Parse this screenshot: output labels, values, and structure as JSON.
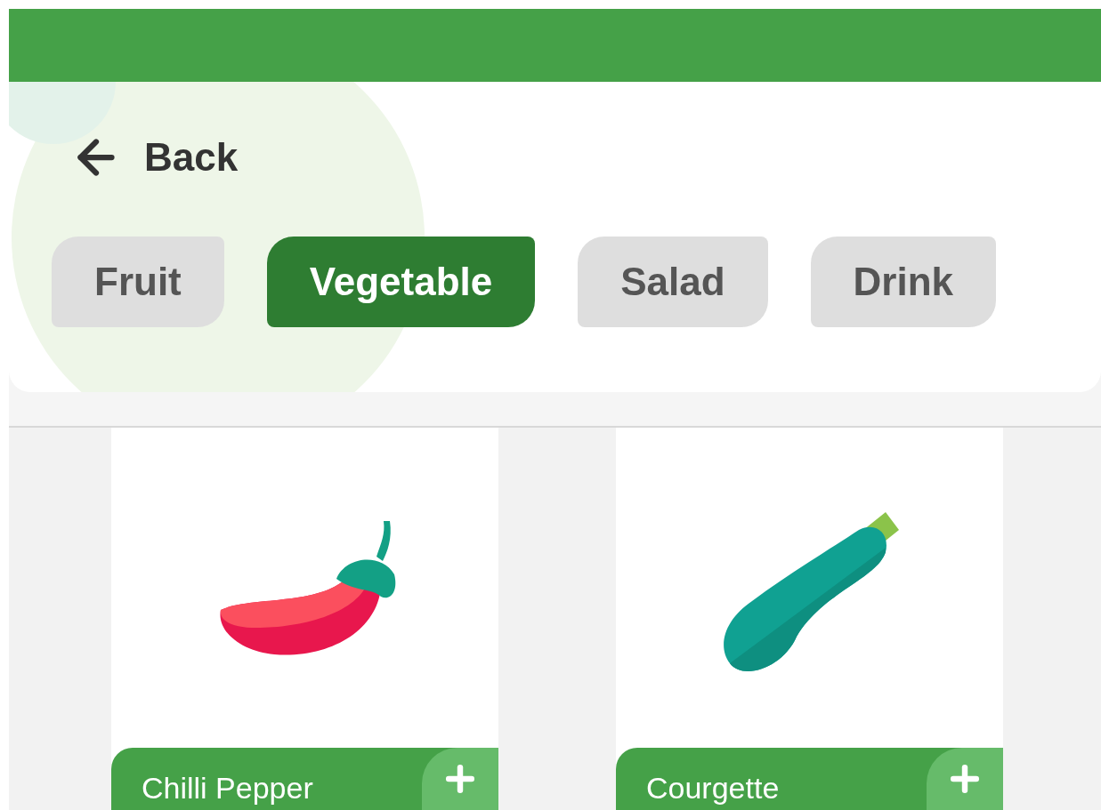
{
  "back": {
    "label": "Back"
  },
  "tabs": [
    {
      "label": "Fruit",
      "selected": false
    },
    {
      "label": "Vegetable",
      "selected": true
    },
    {
      "label": "Salad",
      "selected": false
    },
    {
      "label": "Drink",
      "selected": false
    }
  ],
  "products": [
    {
      "name": "Chilli Pepper",
      "kind": "pepper"
    },
    {
      "name": "Courgette",
      "kind": "courgette"
    }
  ]
}
